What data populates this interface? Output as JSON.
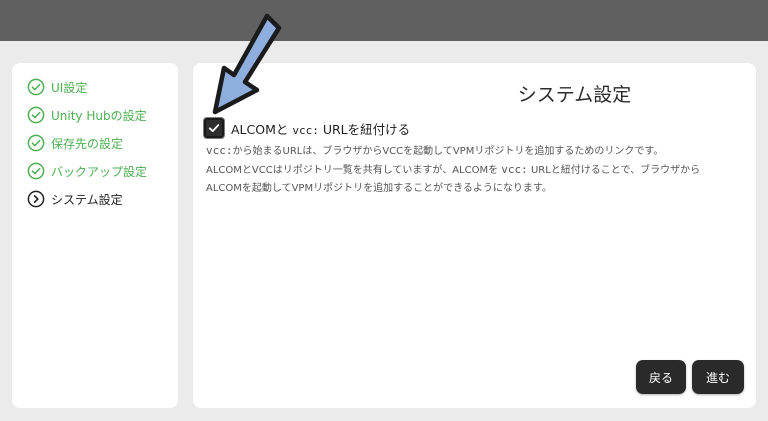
{
  "sidebar": {
    "steps": [
      {
        "label": "UI設定",
        "status": "done"
      },
      {
        "label": "Unity Hubの設定",
        "status": "done"
      },
      {
        "label": "保存先の設定",
        "status": "done"
      },
      {
        "label": "バックアップ設定",
        "status": "done"
      },
      {
        "label": "システム設定",
        "status": "current"
      }
    ]
  },
  "main": {
    "title": "システム設定",
    "checkbox": {
      "checked": true,
      "label_pre": "ALCOMと ",
      "label_code": "vcc:",
      "label_post": " URLを紐付ける"
    },
    "desc": {
      "line1_code": "vcc:",
      "line1_text": "から始まるURLは、ブラウザからVCCを起動してVPMリポジトリを追加するためのリンクです。",
      "line2_pre": "ALCOMとVCCはリポジトリ一覧を共有していますが、ALCOMを ",
      "line2_code": "vcc:",
      "line2_post": " URLと紐付けることで、ブラウザから",
      "line3": "ALCOMを起動してVPMリポジトリを追加することができるようになります。"
    },
    "buttons": {
      "back": "戻る",
      "next": "進む"
    }
  },
  "colors": {
    "topbar": "#606060",
    "background": "#ebebeb",
    "done": "#4caf50",
    "button": "#2a2a2a",
    "arrow_fill": "#8eaede"
  },
  "icons": {
    "done": "check-circle-icon",
    "current": "chevron-circle-icon",
    "annotation": "arrow-annotation"
  }
}
